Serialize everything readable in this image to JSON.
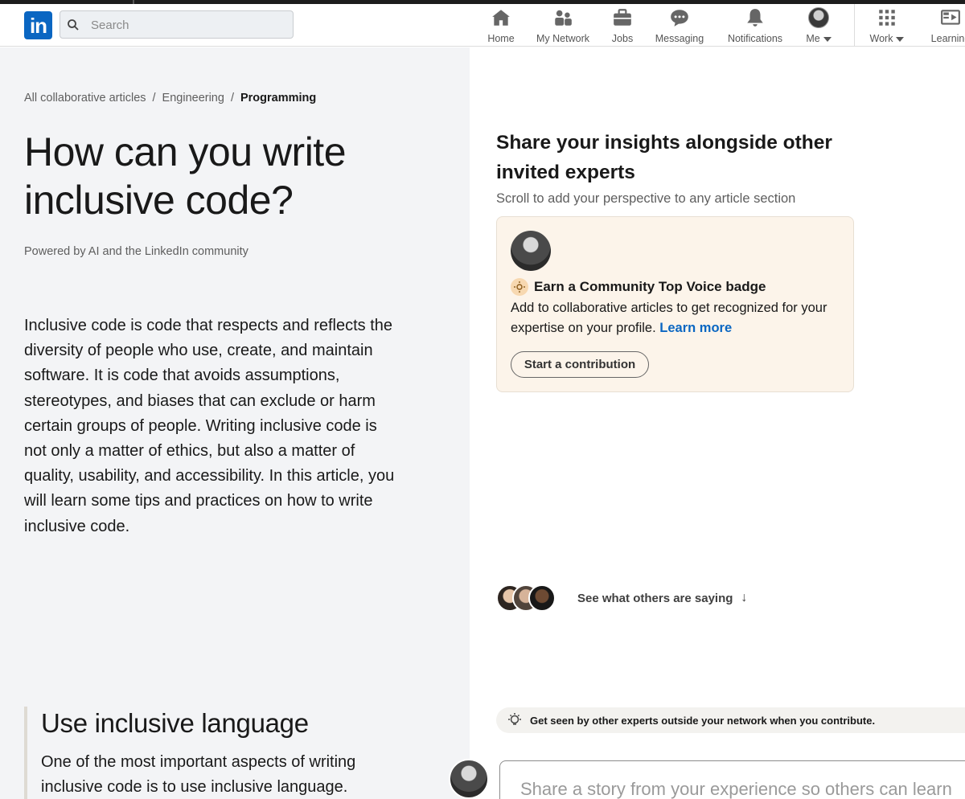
{
  "nav": {
    "search_placeholder": "Search",
    "items": [
      {
        "label": "Home",
        "icon": "home-icon"
      },
      {
        "label": "My Network",
        "icon": "network-icon"
      },
      {
        "label": "Jobs",
        "icon": "briefcase-icon"
      },
      {
        "label": "Messaging",
        "icon": "messaging-icon"
      },
      {
        "label": "Notifications",
        "icon": "bell-icon"
      },
      {
        "label": "Me",
        "icon": "avatar"
      },
      {
        "label": "Work",
        "icon": "grid-icon"
      },
      {
        "label": "Learning",
        "icon": "learning-icon"
      }
    ]
  },
  "breadcrumb": {
    "items": [
      "All collaborative articles",
      "Engineering",
      "Programming"
    ],
    "separator": "/"
  },
  "article": {
    "title": "How can you write inclusive code?",
    "powered_by": "Powered by AI and the LinkedIn community",
    "intro": "Inclusive code is code that respects and reflects the diversity of people who use, create, and maintain software. It is code that avoids assumptions, stereotypes, and biases that can exclude or harm certain groups of people. Writing inclusive code is not only a matter of ethics, but also a matter of quality, usability, and accessibility. In this article, you will learn some tips and practices on how to write inclusive code.",
    "section": {
      "heading": "Use inclusive language",
      "text": "One of the most important aspects of writing inclusive code is to use inclusive language."
    }
  },
  "sidebar": {
    "heading": "Share your insights alongside other invited experts",
    "subheading": "Scroll to add your perspective to any article section",
    "card": {
      "badge_title": "Earn a Community Top Voice badge",
      "description": "Add to collaborative articles to get recognized for your expertise on your profile.",
      "learn_more": "Learn more",
      "button": "Start a contribution"
    },
    "others_label": "See what others are saying",
    "others_arrow": "↓",
    "tip": "Get seen by other experts outside your network when you contribute.",
    "compose_placeholder": "Share a story from your experience so others can learn"
  },
  "colors": {
    "brand": "#0a66c2",
    "card_bg": "#fcf4ea",
    "left_bg": "#f3f4f6"
  }
}
